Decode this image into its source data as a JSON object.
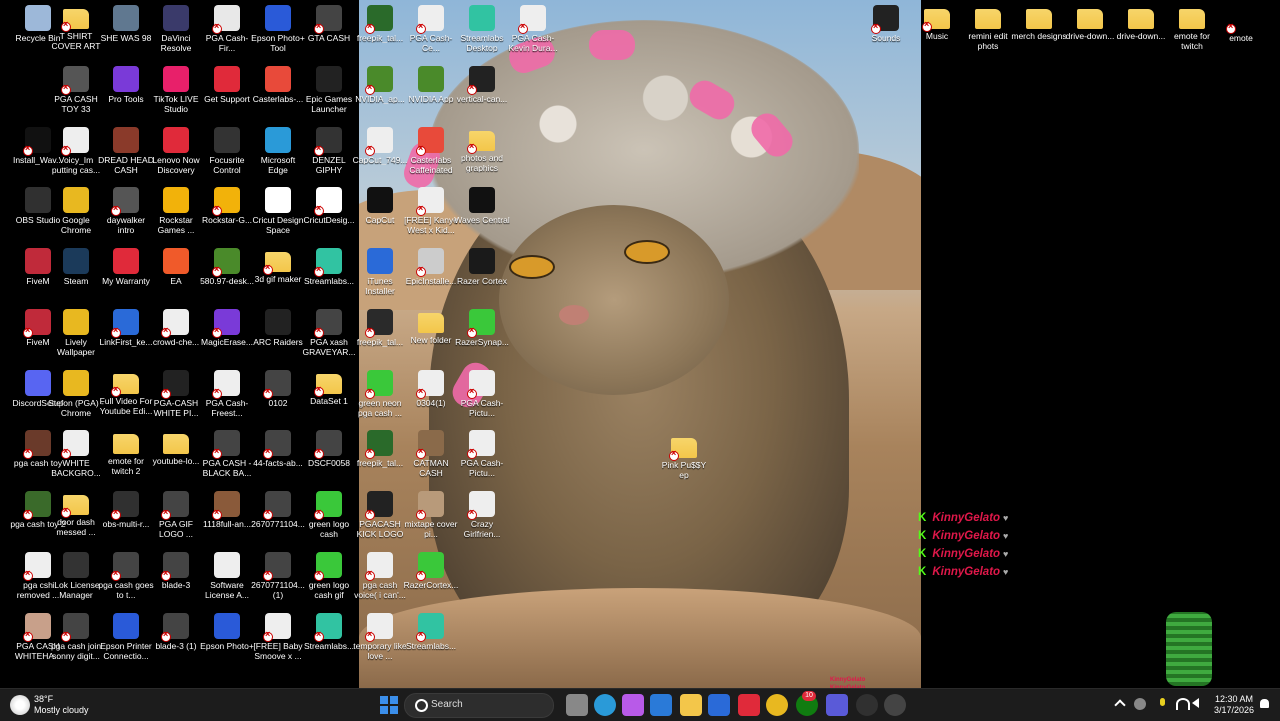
{
  "desktop_icons": [
    {
      "label": "Recycle Bin",
      "icon": "recycle-bin-icon",
      "color": "#9db8d9",
      "col": 0,
      "row": 0,
      "bad": false
    },
    {
      "label": "T SHIRT COVER ART",
      "icon": "folder-icon",
      "color": "#f3c64a",
      "col": 1,
      "row": 0,
      "bad": true
    },
    {
      "label": "SHE WAS 98",
      "icon": "image-icon",
      "color": "#607890",
      "col": 2,
      "row": 0,
      "bad": false
    },
    {
      "label": "DaVinci Resolve",
      "icon": "davinci-icon",
      "color": "#3a3a6a",
      "col": 3,
      "row": 0,
      "bad": false
    },
    {
      "label": "PGA Cash-Fir...",
      "icon": "video-file-icon",
      "color": "#e8e8e8",
      "col": 4,
      "row": 0,
      "bad": true
    },
    {
      "label": "Epson Photo+ Tool",
      "icon": "epson-icon",
      "color": "#2a5ad8",
      "col": 5,
      "row": 0,
      "bad": false
    },
    {
      "label": "GTA CASH",
      "icon": "video-file-icon",
      "color": "#444",
      "col": 6,
      "row": 0,
      "bad": true
    },
    {
      "label": "PGA CASH TOY 33",
      "icon": "image-icon",
      "color": "#555",
      "col": 1,
      "row": 1,
      "bad": true
    },
    {
      "label": "Pro Tools",
      "icon": "protools-icon",
      "color": "#7a3ad8",
      "col": 2,
      "row": 1,
      "bad": false
    },
    {
      "label": "TikTok LIVE Studio",
      "icon": "tiktok-icon",
      "color": "#e8206a",
      "col": 3,
      "row": 1,
      "bad": false
    },
    {
      "label": "Get Support",
      "icon": "support-icon",
      "color": "#e02a3a",
      "col": 4,
      "row": 1,
      "bad": false
    },
    {
      "label": "Casterlabs-...",
      "icon": "casterlabs-icon",
      "color": "#e84a3a",
      "col": 5,
      "row": 1,
      "bad": false
    },
    {
      "label": "Epic Games Launcher",
      "icon": "epic-icon",
      "color": "#222",
      "col": 6,
      "row": 1,
      "bad": false
    },
    {
      "label": "Install_Wav...",
      "icon": "waves-icon",
      "color": "#111",
      "col": 0,
      "row": 2,
      "bad": true
    },
    {
      "label": "Voicy_Im putting cas...",
      "icon": "audio-icon",
      "color": "#eee",
      "col": 1,
      "row": 2,
      "bad": true
    },
    {
      "label": "DREAD HEAD CASH",
      "icon": "image-icon",
      "color": "#8a3a2a",
      "col": 2,
      "row": 2,
      "bad": false
    },
    {
      "label": "Lenovo Now Discovery",
      "icon": "lenovo-icon",
      "color": "#e02a3a",
      "col": 3,
      "row": 2,
      "bad": false
    },
    {
      "label": "Focusrite Control",
      "icon": "focusrite-icon",
      "color": "#333",
      "col": 4,
      "row": 2,
      "bad": false
    },
    {
      "label": "Microsoft Edge",
      "icon": "edge-icon",
      "color": "#2a9ad8",
      "col": 5,
      "row": 2,
      "bad": false
    },
    {
      "label": "DENZEL GIPHY",
      "icon": "image-icon",
      "color": "#333",
      "col": 6,
      "row": 2,
      "bad": true
    },
    {
      "label": "OBS Studio",
      "icon": "obs-icon",
      "color": "#303030",
      "col": 0,
      "row": 3,
      "bad": false
    },
    {
      "label": "Google Chrome",
      "icon": "chrome-icon",
      "color": "#e8b820",
      "col": 1,
      "row": 3,
      "bad": false
    },
    {
      "label": "daywalker intro",
      "icon": "video-file-icon",
      "color": "#555",
      "col": 2,
      "row": 3,
      "bad": true
    },
    {
      "label": "Rockstar Games ...",
      "icon": "rockstar-icon",
      "color": "#f2b20a",
      "col": 3,
      "row": 3,
      "bad": false
    },
    {
      "label": "Rockstar-G...",
      "icon": "rockstar-icon",
      "color": "#f2b20a",
      "col": 4,
      "row": 3,
      "bad": true
    },
    {
      "label": "Cricut Design Space",
      "icon": "cricut-icon",
      "color": "#fff",
      "col": 5,
      "row": 3,
      "bad": false
    },
    {
      "label": "CricutDesig...",
      "icon": "cricut-icon",
      "color": "#fff",
      "col": 6,
      "row": 3,
      "bad": true
    },
    {
      "label": "FiveM",
      "icon": "fivem-icon",
      "color": "#c02a3a",
      "col": 0,
      "row": 4,
      "bad": false
    },
    {
      "label": "Steam",
      "icon": "steam-icon",
      "color": "#1b3a5a",
      "col": 1,
      "row": 4,
      "bad": false
    },
    {
      "label": "My Warranty",
      "icon": "warranty-icon",
      "color": "#e02a3a",
      "col": 2,
      "row": 4,
      "bad": false
    },
    {
      "label": "EA",
      "icon": "ea-icon",
      "color": "#f05a2a",
      "col": 3,
      "row": 4,
      "bad": false
    },
    {
      "label": "580.97-desk...",
      "icon": "nvidia-icon",
      "color": "#4a8a2a",
      "col": 4,
      "row": 4,
      "bad": true
    },
    {
      "label": "3d gif maker",
      "icon": "folder-icon",
      "color": "#f3c64a",
      "col": 5,
      "row": 4,
      "bad": true
    },
    {
      "label": "Streamlabs...",
      "icon": "streamlabs-icon",
      "color": "#31c3a2",
      "col": 6,
      "row": 4,
      "bad": true
    },
    {
      "label": "FiveM",
      "icon": "fivem-icon",
      "color": "#c02a3a",
      "col": 0,
      "row": 5,
      "bad": true
    },
    {
      "label": "Lively Wallpaper",
      "icon": "lively-icon",
      "color": "#e8b820",
      "col": 1,
      "row": 5,
      "bad": false
    },
    {
      "label": "LinkFirst_ke...",
      "icon": "image-icon",
      "color": "#2a6ad8",
      "col": 2,
      "row": 5,
      "bad": true
    },
    {
      "label": "crowd-che...",
      "icon": "video-file-icon",
      "color": "#eee",
      "col": 3,
      "row": 5,
      "bad": true
    },
    {
      "label": "MagicErase...",
      "icon": "magic-icon",
      "color": "#7a3ad8",
      "col": 4,
      "row": 5,
      "bad": true
    },
    {
      "label": "ARC Raiders",
      "icon": "arc-icon",
      "color": "#222",
      "col": 5,
      "row": 5,
      "bad": false
    },
    {
      "label": "PGA xash GRAVEYAR...",
      "icon": "video-file-icon",
      "color": "#444",
      "col": 6,
      "row": 5,
      "bad": true
    },
    {
      "label": "DiscordSetup",
      "icon": "discord-icon",
      "color": "#5865f2",
      "col": 0,
      "row": 6,
      "bad": false
    },
    {
      "label": "Stefon (PGA) - Chrome",
      "icon": "chrome-icon",
      "color": "#e8b820",
      "col": 1,
      "row": 6,
      "bad": false
    },
    {
      "label": "Full Video For Youtube Edi...",
      "icon": "folder-icon",
      "color": "#f3c64a",
      "col": 2,
      "row": 6,
      "bad": true
    },
    {
      "label": "PGA-CASH WHITE PI...",
      "icon": "image-icon",
      "color": "#222",
      "col": 3,
      "row": 6,
      "bad": true
    },
    {
      "label": "PGA Cash-Freest...",
      "icon": "video-file-icon",
      "color": "#eee",
      "col": 4,
      "row": 6,
      "bad": true
    },
    {
      "label": "0102",
      "icon": "video-file-icon",
      "color": "#444",
      "col": 5,
      "row": 6,
      "bad": true
    },
    {
      "label": "DataSet 1",
      "icon": "folder-icon",
      "color": "#f3c64a",
      "col": 6,
      "row": 6,
      "bad": true
    },
    {
      "label": "pga cash toy",
      "icon": "image-icon",
      "color": "#6a3a2a",
      "col": 0,
      "row": 7,
      "bad": true
    },
    {
      "label": "WHITE BACKGRO...",
      "icon": "image-icon",
      "color": "#eee",
      "col": 1,
      "row": 7,
      "bad": true
    },
    {
      "label": "emote for twitch 2",
      "icon": "folder-icon",
      "color": "#f3c64a",
      "col": 2,
      "row": 7,
      "bad": false
    },
    {
      "label": "youtube-lo...",
      "icon": "folder-icon",
      "color": "#f3c64a",
      "col": 3,
      "row": 7,
      "bad": false
    },
    {
      "label": "PGA CASH - BLACK BA...",
      "icon": "video-file-icon",
      "color": "#444",
      "col": 4,
      "row": 7,
      "bad": true
    },
    {
      "label": "44-facts-ab...",
      "icon": "video-file-icon",
      "color": "#444",
      "col": 5,
      "row": 7,
      "bad": true
    },
    {
      "label": "DSCF0058",
      "icon": "video-file-icon",
      "color": "#444",
      "col": 6,
      "row": 7,
      "bad": true
    },
    {
      "label": "pga cash toy 2",
      "icon": "image-icon",
      "color": "#3a6a2a",
      "col": 0,
      "row": 8,
      "bad": true
    },
    {
      "label": "door dash messed ...",
      "icon": "folder-icon",
      "color": "#f3c64a",
      "col": 1,
      "row": 8,
      "bad": true
    },
    {
      "label": "obs-multi-r...",
      "icon": "obs-icon",
      "color": "#303030",
      "col": 2,
      "row": 8,
      "bad": true
    },
    {
      "label": "PGA GIF LOGO ...",
      "icon": "video-file-icon",
      "color": "#444",
      "col": 3,
      "row": 8,
      "bad": true
    },
    {
      "label": "1118full-an...",
      "icon": "image-icon",
      "color": "#8a5a3a",
      "col": 4,
      "row": 8,
      "bad": true
    },
    {
      "label": "2670771104...",
      "icon": "video-file-icon",
      "color": "#444",
      "col": 5,
      "row": 8,
      "bad": true
    },
    {
      "label": "green logo cash",
      "icon": "image-icon",
      "color": "#3ac83a",
      "col": 6,
      "row": 8,
      "bad": true
    },
    {
      "label": "pga csh removed ...",
      "icon": "image-icon",
      "color": "#eee",
      "col": 0,
      "row": 9,
      "bad": true
    },
    {
      "label": "iLok License Manager",
      "icon": "ilok-icon",
      "color": "#333",
      "col": 1,
      "row": 9,
      "bad": false
    },
    {
      "label": "pga cash goes to t...",
      "icon": "video-file-icon",
      "color": "#444",
      "col": 2,
      "row": 9,
      "bad": true
    },
    {
      "label": "blade-3",
      "icon": "video-file-icon",
      "color": "#444",
      "col": 3,
      "row": 9,
      "bad": true
    },
    {
      "label": "Software License A...",
      "icon": "document-icon",
      "color": "#eee",
      "col": 4,
      "row": 9,
      "bad": false
    },
    {
      "label": "2670771104... (1)",
      "icon": "video-file-icon",
      "color": "#444",
      "col": 5,
      "row": 9,
      "bad": true
    },
    {
      "label": "green logo cash gif",
      "icon": "image-icon",
      "color": "#3ac83a",
      "col": 6,
      "row": 9,
      "bad": true
    },
    {
      "label": "PGA CASH WHITEHA...",
      "icon": "image-icon",
      "color": "#c8a08a",
      "col": 0,
      "row": 10,
      "bad": true
    },
    {
      "label": "pga cash join sonny digit...",
      "icon": "video-file-icon",
      "color": "#444",
      "col": 1,
      "row": 10,
      "bad": true
    },
    {
      "label": "Epson Printer Connectio...",
      "icon": "epson-icon",
      "color": "#2a5ad8",
      "col": 2,
      "row": 10,
      "bad": false
    },
    {
      "label": "blade-3 (1)",
      "icon": "video-file-icon",
      "color": "#444",
      "col": 3,
      "row": 10,
      "bad": true
    },
    {
      "label": "Epson Photo+",
      "icon": "epson-icon",
      "color": "#2a5ad8",
      "col": 4,
      "row": 10,
      "bad": false
    },
    {
      "label": "[FREE] Baby Smoove x ...",
      "icon": "audio-icon",
      "color": "#eee",
      "col": 5,
      "row": 10,
      "bad": true
    },
    {
      "label": "Streamlabs...",
      "icon": "streamlabs-icon",
      "color": "#31c3a2",
      "col": 6,
      "row": 10,
      "bad": true
    },
    {
      "label": "freepik_tal...",
      "icon": "image-icon",
      "color": "#2a6a2a",
      "col": 7,
      "row": 0,
      "bad": true
    },
    {
      "label": "PGA Cash-Ce...",
      "icon": "video-file-icon",
      "color": "#eee",
      "col": 8,
      "row": 0,
      "bad": true
    },
    {
      "label": "Streamlabs Desktop",
      "icon": "streamlabs-icon",
      "color": "#31c3a2",
      "col": 9,
      "row": 0,
      "bad": false
    },
    {
      "label": "PGA Cash-Kevin Dura...",
      "icon": "video-file-icon",
      "color": "#eee",
      "col": 10,
      "row": 0,
      "bad": true
    },
    {
      "label": "NVIDIA_ap...",
      "icon": "nvidia-icon",
      "color": "#4a8a2a",
      "col": 7,
      "row": 1,
      "bad": true
    },
    {
      "label": "NVIDIA App",
      "icon": "nvidia-icon",
      "color": "#4a8a2a",
      "col": 8,
      "row": 1,
      "bad": false
    },
    {
      "label": "vertical-can...",
      "icon": "video-file-icon",
      "color": "#222",
      "col": 9,
      "row": 1,
      "bad": true
    },
    {
      "label": "CapCut_749...",
      "icon": "capcut-icon",
      "color": "#eee",
      "col": 7,
      "row": 2,
      "bad": true
    },
    {
      "label": "Casterlabs Caffeinated",
      "icon": "casterlabs-icon",
      "color": "#e84a3a",
      "col": 8,
      "row": 2,
      "bad": true
    },
    {
      "label": "photos and graphics",
      "icon": "folder-icon",
      "color": "#f3c64a",
      "col": 9,
      "row": 2,
      "bad": true
    },
    {
      "label": "CapCut",
      "icon": "capcut-icon",
      "color": "#111",
      "col": 7,
      "row": 3,
      "bad": false
    },
    {
      "label": "[FREE] Kanye West x Kid...",
      "icon": "audio-icon",
      "color": "#eee",
      "col": 8,
      "row": 3,
      "bad": true
    },
    {
      "label": "Waves Central",
      "icon": "waves-icon",
      "color": "#111",
      "col": 9,
      "row": 3,
      "bad": false
    },
    {
      "label": "iTunes Installer",
      "icon": "itunes-icon",
      "color": "#2a6ad8",
      "col": 7,
      "row": 4,
      "bad": false
    },
    {
      "label": "EpicInstalle...",
      "icon": "epic-icon",
      "color": "#ccc",
      "col": 8,
      "row": 4,
      "bad": true
    },
    {
      "label": "Razer Cortex",
      "icon": "razer-icon",
      "color": "#1a1a1a",
      "col": 9,
      "row": 4,
      "bad": false
    },
    {
      "label": "freepik_tal...",
      "icon": "image-icon",
      "color": "#2a2a2a",
      "col": 7,
      "row": 5,
      "bad": true
    },
    {
      "label": "New folder",
      "icon": "folder-icon",
      "color": "#f3c64a",
      "col": 8,
      "row": 5,
      "bad": false
    },
    {
      "label": "RazerSynap...",
      "icon": "razer-icon",
      "color": "#3ac83a",
      "col": 9,
      "row": 5,
      "bad": true
    },
    {
      "label": "green neon pga cash ...",
      "icon": "image-icon",
      "color": "#3ac83a",
      "col": 7,
      "row": 6,
      "bad": true
    },
    {
      "label": "0304(1)",
      "icon": "video-file-icon",
      "color": "#eee",
      "col": 8,
      "row": 6,
      "bad": true
    },
    {
      "label": "PGA Cash-Pictu...",
      "icon": "video-file-icon",
      "color": "#eee",
      "col": 9,
      "row": 6,
      "bad": true
    },
    {
      "label": "freepik_tal...",
      "icon": "image-icon",
      "color": "#2a6a2a",
      "col": 7,
      "row": 7,
      "bad": true
    },
    {
      "label": "CATMAN CASH",
      "icon": "image-icon",
      "color": "#8a6a4a",
      "col": 8,
      "row": 7,
      "bad": true
    },
    {
      "label": "PGA Cash-Pictu...",
      "icon": "video-file-icon",
      "color": "#eee",
      "col": 9,
      "row": 7,
      "bad": true
    },
    {
      "label": "PGACASH KICK LOGO",
      "icon": "image-icon",
      "color": "#222",
      "col": 7,
      "row": 8,
      "bad": true
    },
    {
      "label": "mixtape cover pi...",
      "icon": "image-icon",
      "color": "#b89a7a",
      "col": 8,
      "row": 8,
      "bad": true
    },
    {
      "label": "Crazy Girlfrien...",
      "icon": "video-file-icon",
      "color": "#eee",
      "col": 9,
      "row": 8,
      "bad": true
    },
    {
      "label": "pga cash voice( i can'...",
      "icon": "audio-icon",
      "color": "#eee",
      "col": 7,
      "row": 9,
      "bad": true
    },
    {
      "label": "RazerCortex...",
      "icon": "razer-icon",
      "color": "#3ac83a",
      "col": 8,
      "row": 9,
      "bad": true
    },
    {
      "label": "temporary like love ...",
      "icon": "audio-icon",
      "color": "#eee",
      "col": 7,
      "row": 10,
      "bad": true
    },
    {
      "label": "Streamlabs...",
      "icon": "streamlabs-icon",
      "color": "#31c3a2",
      "col": 8,
      "row": 10,
      "bad": true
    },
    {
      "label": "Pink Pu$$Y ep",
      "icon": "folder-icon",
      "color": "#f3c64a",
      "col": "pink",
      "row": "pink",
      "bad": true
    },
    {
      "label": "Sounds",
      "icon": "sounds-icon",
      "color": "#222",
      "col": "sounds",
      "row": 0,
      "bad": true
    },
    {
      "label": "Music",
      "icon": "folder-icon",
      "color": "#f3c64a",
      "col": "r0",
      "row": 0,
      "bad": true
    },
    {
      "label": "remini edit phots",
      "icon": "folder-icon",
      "color": "#f3c64a",
      "col": "r1",
      "row": 0,
      "bad": false
    },
    {
      "label": "merch designs",
      "icon": "folder-icon",
      "color": "#f3c64a",
      "col": "r2",
      "row": 0,
      "bad": false
    },
    {
      "label": "drive-down...",
      "icon": "folder-icon",
      "color": "#f3c64a",
      "col": "r3",
      "row": 0,
      "bad": false
    },
    {
      "label": "drive-down...",
      "icon": "folder-icon",
      "color": "#f3c64a",
      "col": "r4",
      "row": 0,
      "bad": false
    },
    {
      "label": "emote for twitch",
      "icon": "folder-icon",
      "color": "#f3c64a",
      "col": "r5",
      "row": 0,
      "bad": false
    },
    {
      "label": "emote",
      "icon": "file-icon",
      "color": "#000",
      "col": "r6",
      "row": 0,
      "bad": true
    }
  ],
  "chat_overlay": {
    "messages": [
      "KinnyGelato",
      "KinnyGelato",
      "KinnyGelato",
      "KinnyGelato"
    ],
    "platform_icon": "kick-icon",
    "accent": "#e0184a"
  },
  "mini_chat": [
    "KinnyGelato",
    "KinnyGelato",
    "KinnyGelato"
  ],
  "taskbar": {
    "weather_temp": "38°F",
    "weather_desc": "Mostly cloudy",
    "search_placeholder": "Search",
    "time": "12:30 AM",
    "date": "3/17/2026",
    "pinned": [
      {
        "name": "start-icon",
        "color": "#3b8eea"
      },
      {
        "name": "task-view-icon",
        "color": "#888"
      },
      {
        "name": "edge-icon",
        "color": "#2a9ad8"
      },
      {
        "name": "copilot-icon",
        "color": "#b85ae8"
      },
      {
        "name": "pen-app-icon",
        "color": "#2a7ad8"
      },
      {
        "name": "file-explorer-icon",
        "color": "#f3c64a"
      },
      {
        "name": "mail-icon",
        "color": "#2a6ad8"
      },
      {
        "name": "l-app-icon",
        "color": "#e02a3a"
      },
      {
        "name": "chrome-icon",
        "color": "#e8b820"
      },
      {
        "name": "xbox-icon",
        "color": "#107c10"
      },
      {
        "name": "teams-icon",
        "color": "#5a5ad8"
      },
      {
        "name": "obs-icon",
        "color": "#303030"
      },
      {
        "name": "media-icon",
        "color": "#444"
      }
    ],
    "xbox_badge": "10"
  },
  "colors": {
    "desktop_bg": "#000000",
    "taskbar_bg": "#1c1c1c",
    "folder": "#f3c64a"
  }
}
